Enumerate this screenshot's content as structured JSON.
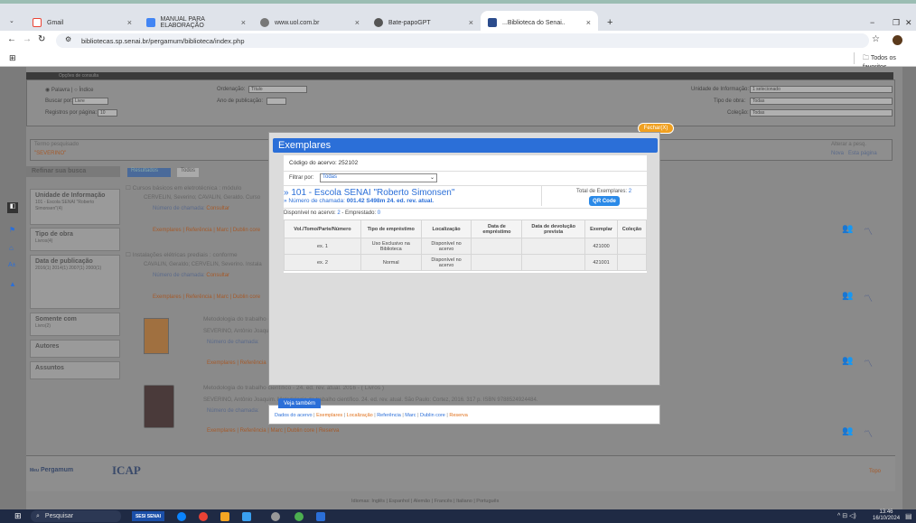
{
  "browser": {
    "tabs": [
      {
        "label": "Gmail",
        "color": "#ea4335",
        "active": false
      },
      {
        "label": "MANUAL PARA ELABORAÇÃO",
        "color": "#4285f4",
        "active": false
      },
      {
        "label": "www.uol.com.br",
        "color": "#555555",
        "active": false
      },
      {
        "label": "Bate-papoGPT",
        "color": "#555555",
        "active": false
      },
      {
        "label": "...Biblioteca do Senai..",
        "color": "#2b4c8c",
        "active": true
      }
    ],
    "new_tab": "+",
    "url": "bibliotecas.sp.senai.br/pergamum/biblioteca/index.php",
    "bookmarks_folder": "Todos os favoritos"
  },
  "search_panel": {
    "header": "Opções de consulta",
    "radio_simple": "Palavra",
    "radio_index": "Índice",
    "ordenacao_label": "Ordenação:",
    "ordenacao_value": "Título",
    "buscar_label": "Buscar por:",
    "buscar_value": "Livre",
    "ano_label": "Ano de publicação:",
    "registros_label": "Registros por página:",
    "registros_value": "10",
    "unidade_label": "Unidade de Informação:",
    "unidade_value": "1 selecionado",
    "tipo_label": "Tipo de obra:",
    "tipo_value": "Todas",
    "colecao_label": "Coleção:",
    "colecao_value": "Todas",
    "termo_label": "Termo pesquisado",
    "termo_value": "\"SEVERINO\"",
    "alterar_label": "Alterar a pesq.",
    "novo_btn": "Nova",
    "outra_btn": "Esta página"
  },
  "refine": {
    "title": "Refinar sua busca",
    "tabs": [
      "Resultados",
      "Todos"
    ],
    "groups": [
      {
        "title": "Unidade de Informação",
        "items": "101 - Escola SENAI \"Roberto Simonsen\"(4)"
      },
      {
        "title": "Tipo de obra",
        "items": "Livros(4)"
      },
      {
        "title": "Data de publicação",
        "items": "2016(1) 2014(1) 2007(1) 2000(1)"
      },
      {
        "title": "Somente com",
        "items": "Livro(2)"
      },
      {
        "title": "Autores",
        "items": ""
      },
      {
        "title": "Assuntos",
        "items": ""
      }
    ]
  },
  "results": [
    {
      "title": "Cursos básicos em eletrotécnica : módulo",
      "author": "CERVELIN, Severino; CAVALIN, Geraldo. Curso",
      "call": "Número de chamada:",
      "call_link": "Consultar",
      "links": "Exemplares | Referência | Marc | Dublin core"
    },
    {
      "title": "Instalações elétricas prediais : conforme",
      "author": "CAVALIN, Geraldo; CERVELIN, Severino. Instala",
      "call": "Número de chamada:",
      "call_link": "Consultar",
      "links": "Exemplares | Referência | Marc | Dublin core"
    },
    {
      "title": "Metodologia do trabalho científico",
      "author": "SEVERINO, Antônio Joaquim.",
      "call": "Número de chamada:",
      "call_link": "",
      "links": "Exemplares | Referência"
    },
    {
      "title": "Metodologia do trabalho científico - 24. ed. rev. atual. 2016 - ( Livros )",
      "author": "SEVERINO, Antônio Joaquim. Metodologia do trabalho científico. 24. ed. rev. atual. São Paulo: Cortez, 2016. 317 p. ISBN 9788524924484.",
      "call": "Número de chamada:",
      "call_link": "",
      "links": "Exemplares | Referência | Marc | Dublin core | Reserva"
    }
  ],
  "modal": {
    "close_btn": "Fechar(X)",
    "title": "Exemplares",
    "codigo": "Código do acervo: 252102",
    "filtrar_label": "Filtrar por:",
    "filtrar_value": "Todas",
    "library": "» 101 - Escola SENAI \"Roberto Simonsen\"",
    "numero_label": "» Número de chamada:",
    "numero_value": "001.42 S498m 24. ed. rev. atual.",
    "total_label": "Total de Exemplares:",
    "total_value": "2",
    "qr_btn": "QR Code",
    "disponivel_label": "Disponível no acervo:",
    "disponivel_value": "2",
    "emprestado_label": "- Emprestado:",
    "emprestado_value": "0",
    "columns": [
      "Vol./Tomo/Parte/Número",
      "Tipo de empréstimo",
      "Localização",
      "Data de empréstimo",
      "Data de devolução prevista",
      "Exemplar",
      "Coleção"
    ],
    "rows": [
      [
        "ex. 1",
        "Uso Exclusivo na Biblioteca",
        "Disponível no acervo",
        "",
        "",
        "421000",
        ""
      ],
      [
        "ex. 2",
        "Normal",
        "Disponível no acervo",
        "",
        "",
        "421001",
        ""
      ]
    ]
  },
  "veja": {
    "tab": "Veja também",
    "links": [
      "Dados do acervo",
      "Exemplares",
      "Localização",
      "Referência",
      "Marc",
      "Dublin core",
      "Reserva"
    ]
  },
  "footer": {
    "logo1": "Pergamum",
    "logo1_small": "Meu",
    "logo2": "ICAP",
    "topo": "Topo",
    "idiomas": "Idiomas: Inglês | Espanhol | Alemão | Francês | Italiano | Português"
  },
  "taskbar": {
    "search": "Pesquisar",
    "time": "13:46",
    "date": "16/10/2024",
    "sesi": "SESI SENAI"
  }
}
